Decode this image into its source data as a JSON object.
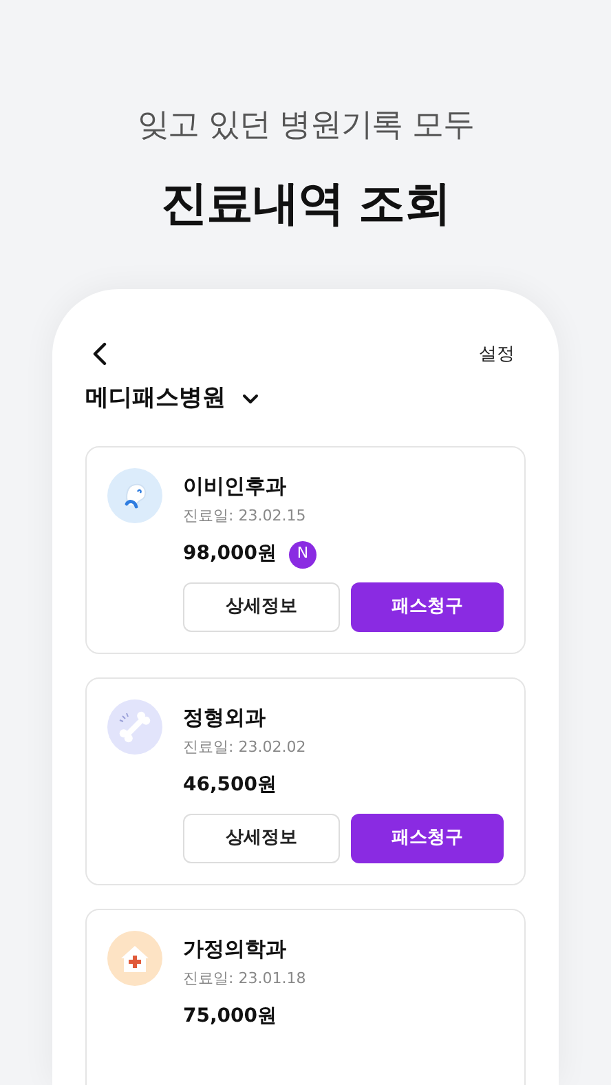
{
  "headline": {
    "subtitle": "잊고 있던 병원기록 모두",
    "title": "진료내역 조회"
  },
  "phone": {
    "header": {
      "settings": "설정"
    },
    "hospital": "메디패스병원",
    "records": [
      {
        "kind": "ear",
        "color": "#dcecfb",
        "department": "이비인후과",
        "date": "진료일: 23.02.15",
        "amount": "98,000원",
        "new": true,
        "badge": "N",
        "buttons": [
          "상세정보",
          "패스청구"
        ]
      },
      {
        "kind": "bone",
        "color": "#e2e4fb",
        "department": "정형외과",
        "date": "진료일: 23.02.02",
        "amount": "46,500원",
        "new": false,
        "buttons": [
          "상세정보",
          "패스청구"
        ]
      },
      {
        "kind": "house",
        "color": "#fde3c4",
        "department": "가정의학과",
        "date": "진료일: 23.01.18",
        "amount": "75,000원",
        "new": false
      }
    ]
  }
}
